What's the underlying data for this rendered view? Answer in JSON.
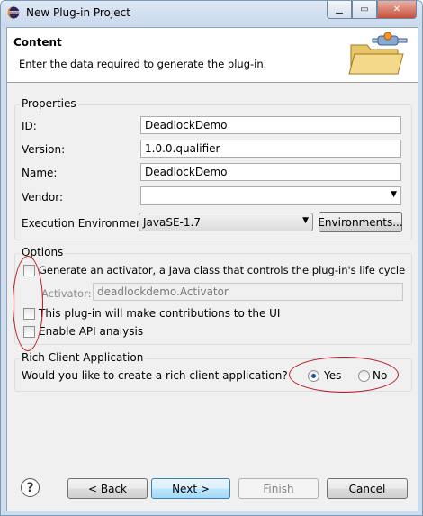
{
  "window": {
    "title": "New Plug-in Project",
    "icon": "eclipse-icon",
    "buttons": {
      "minimize": "minimize-icon",
      "maximize": "maximize-icon",
      "close": "close-icon"
    }
  },
  "header": {
    "title": "Content",
    "description": "Enter the data required to generate the plug-in.",
    "banner": "plugin-folder-icon"
  },
  "properties": {
    "group_label": "Properties",
    "id_label": "ID:",
    "id_value": "DeadlockDemo",
    "version_label": "Version:",
    "version_value": "1.0.0.qualifier",
    "name_label": "Name:",
    "name_value": "DeadlockDemo",
    "vendor_label": "Vendor:",
    "vendor_value": "",
    "exec_env_label": "Execution Environment:",
    "exec_env_value": "JavaSE-1.7",
    "environments_button": "Environments..."
  },
  "options": {
    "group_label": "Options",
    "generate_activator_label": "Generate an activator, a Java class that controls the plug-in's life cycle",
    "generate_activator_checked": false,
    "activator_label": "Activator:",
    "activator_value": "deadlockdemo.Activator",
    "contributions_label": "This plug-in will make contributions to the UI",
    "contributions_checked": false,
    "api_analysis_label": "Enable API analysis",
    "api_analysis_checked": false
  },
  "rcp": {
    "group_label": "Rich Client Application",
    "question": "Would you like to create a rich client application?",
    "yes_label": "Yes",
    "no_label": "No",
    "selected": "Yes"
  },
  "footer": {
    "help": "?",
    "back": "< Back",
    "next": "Next >",
    "finish": "Finish",
    "cancel": "Cancel"
  },
  "colors": {
    "annotation": "#c0181f",
    "primary_button_border": "#3c7fb1",
    "window_frame": "#cfdcec"
  }
}
